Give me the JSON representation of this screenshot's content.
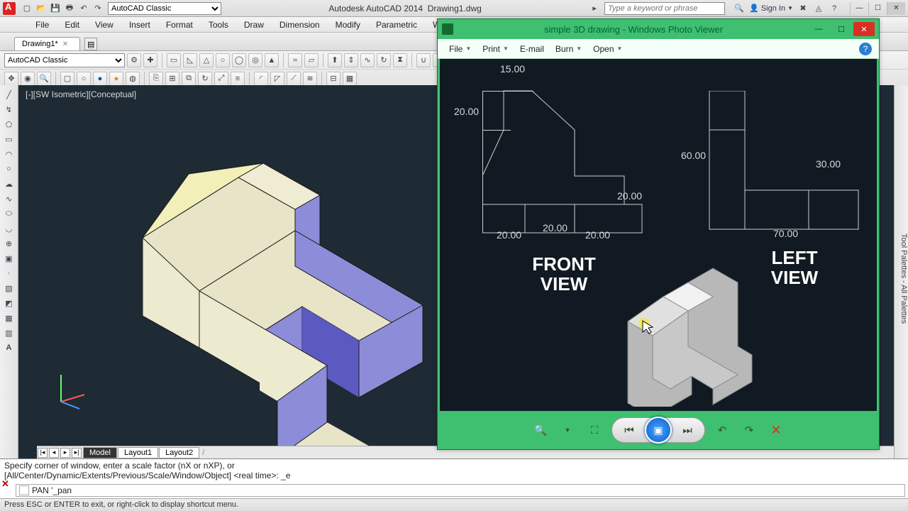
{
  "titlebar": {
    "workspace": "AutoCAD Classic",
    "app": "Autodesk AutoCAD 2014",
    "doc": "Drawing1.dwg",
    "search_placeholder": "Type a keyword or phrase",
    "signin": "Sign In"
  },
  "menus": [
    "File",
    "Edit",
    "View",
    "Insert",
    "Format",
    "Tools",
    "Draw",
    "Dimension",
    "Modify",
    "Parametric",
    "Window"
  ],
  "doctab": {
    "name": "Drawing1*"
  },
  "layer_select": "AutoCAD Classic",
  "viewport_label": "[-][SW Isometric][Conceptual]",
  "layout_tabs": {
    "nav": [
      "|◂",
      "◂",
      "▸",
      "▸|"
    ],
    "tabs": [
      "Model",
      "Layout1",
      "Layout2"
    ],
    "active": "Model"
  },
  "command": {
    "line1": "Specify corner of window, enter a scale factor (nX or nXP), or",
    "line2": "[All/Center/Dynamic/Extents/Previous/Scale/Window/Object] <real time>: _e",
    "prompt": "PAN '_pan"
  },
  "statusbar": "Press ESC or ENTER to exit, or right-click to display shortcut menu.",
  "right_palette": "Tool Palettes - All Palettes",
  "photo_viewer": {
    "title": "simple 3D drawing - Windows Photo Viewer",
    "menus": [
      "File",
      "Print",
      "E-mail",
      "Burn",
      "Open"
    ],
    "labels": {
      "front": "FRONT VIEW",
      "left": "LEFT VIEW"
    },
    "dims": {
      "d15": "15.00",
      "d20a": "20.00",
      "d20b": "20.00",
      "d20c": "20.00",
      "d20d": "20.00",
      "d20e": "20.00",
      "d60": "60.00",
      "d30": "30.00",
      "d70": "70.00"
    }
  }
}
